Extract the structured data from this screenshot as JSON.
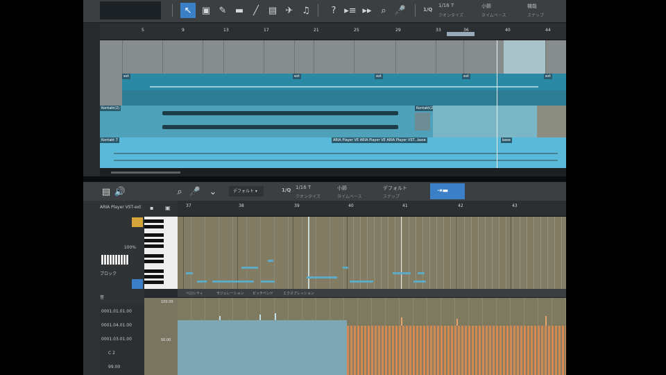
{
  "toolbar": {
    "left_box_label": "",
    "icons": [
      "select-arrow-icon",
      "range-tool-icon",
      "pencil-icon",
      "eraser-icon",
      "paint-icon",
      "split-icon",
      "mute-tool-icon",
      "listen-icon",
      "help-icon",
      "snap-forward-icon",
      "snap-next-icon",
      "zoom-icon",
      "scrub-icon"
    ],
    "quantize": {
      "value": "1/16 T",
      "label": "クオンタイズ"
    },
    "timebase": {
      "value": "小節",
      "label": "タイムベース"
    },
    "snap": {
      "value": "機能",
      "label": "スナップ"
    }
  },
  "ruler1": {
    "ticks": [
      "5",
      "9",
      "13",
      "17",
      "21",
      "25",
      "29",
      "33",
      "36",
      "40",
      "44"
    ]
  },
  "clips": {
    "track1_names": [
      "ext",
      "ext",
      "ext",
      "ext",
      "ext"
    ],
    "track2_names": [
      "Kontakt(2)",
      "Kontakt(2)"
    ],
    "track3_names": [
      "Kontakt 7",
      "ARIA Player VE ARIA Player VE ARIA Player VST...base",
      "base"
    ]
  },
  "editor_bar": {
    "dropdown": "デフォルト",
    "quantize": {
      "value": "1/16 T",
      "label": "クオンタイズ"
    },
    "timebase": {
      "value": "小節",
      "label": "タイムベース"
    },
    "snap": {
      "value": "デフォルト",
      "label": "スナップ"
    }
  },
  "left_panel": {
    "instrument": "ARIA Player VST-ext",
    "zoom": "100%",
    "mode": "ブロック",
    "dropdown": "音",
    "values": [
      "0001.01.01.00",
      "0001.04.01.00",
      "0001.03.01.00",
      "C 2",
      "99.00"
    ]
  },
  "ruler2": {
    "ticks": [
      "37",
      "38",
      "39",
      "40",
      "41",
      "42",
      "43"
    ]
  },
  "velocity": {
    "tab": "ベロシティ",
    "other_tabs": [
      "モジュレーション",
      "ピッチベンド",
      "エクスプレッション"
    ],
    "scale": [
      "100.00",
      "50.00"
    ]
  },
  "colors": {
    "accent": "#3b7fc7",
    "clip_dark": "#2a8aa5",
    "clip_light": "#5ab9d8",
    "note": "#5fa9c8",
    "vel_blue": "#8fb0c0",
    "vel_orange": "#d08a52"
  }
}
